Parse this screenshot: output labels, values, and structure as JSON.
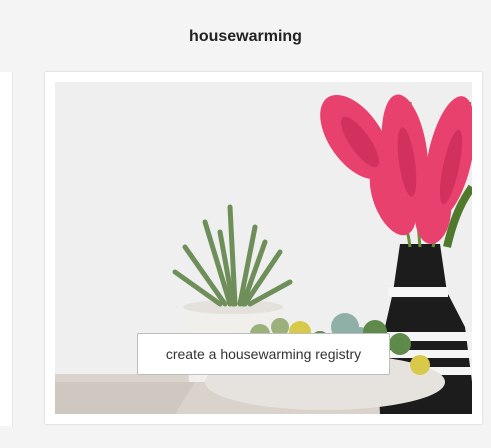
{
  "section": {
    "title": "housewarming"
  },
  "card": {
    "image": {
      "description_icon": "houseplants-photo"
    },
    "cta_label": "create a housewarming registry"
  },
  "colors": {
    "title_text": "#222222",
    "button_border": "#bdbdbd",
    "flower_pink": "#e8416e",
    "vase_black": "#1c1c1c",
    "succulent_green": "#6f8f5a"
  }
}
